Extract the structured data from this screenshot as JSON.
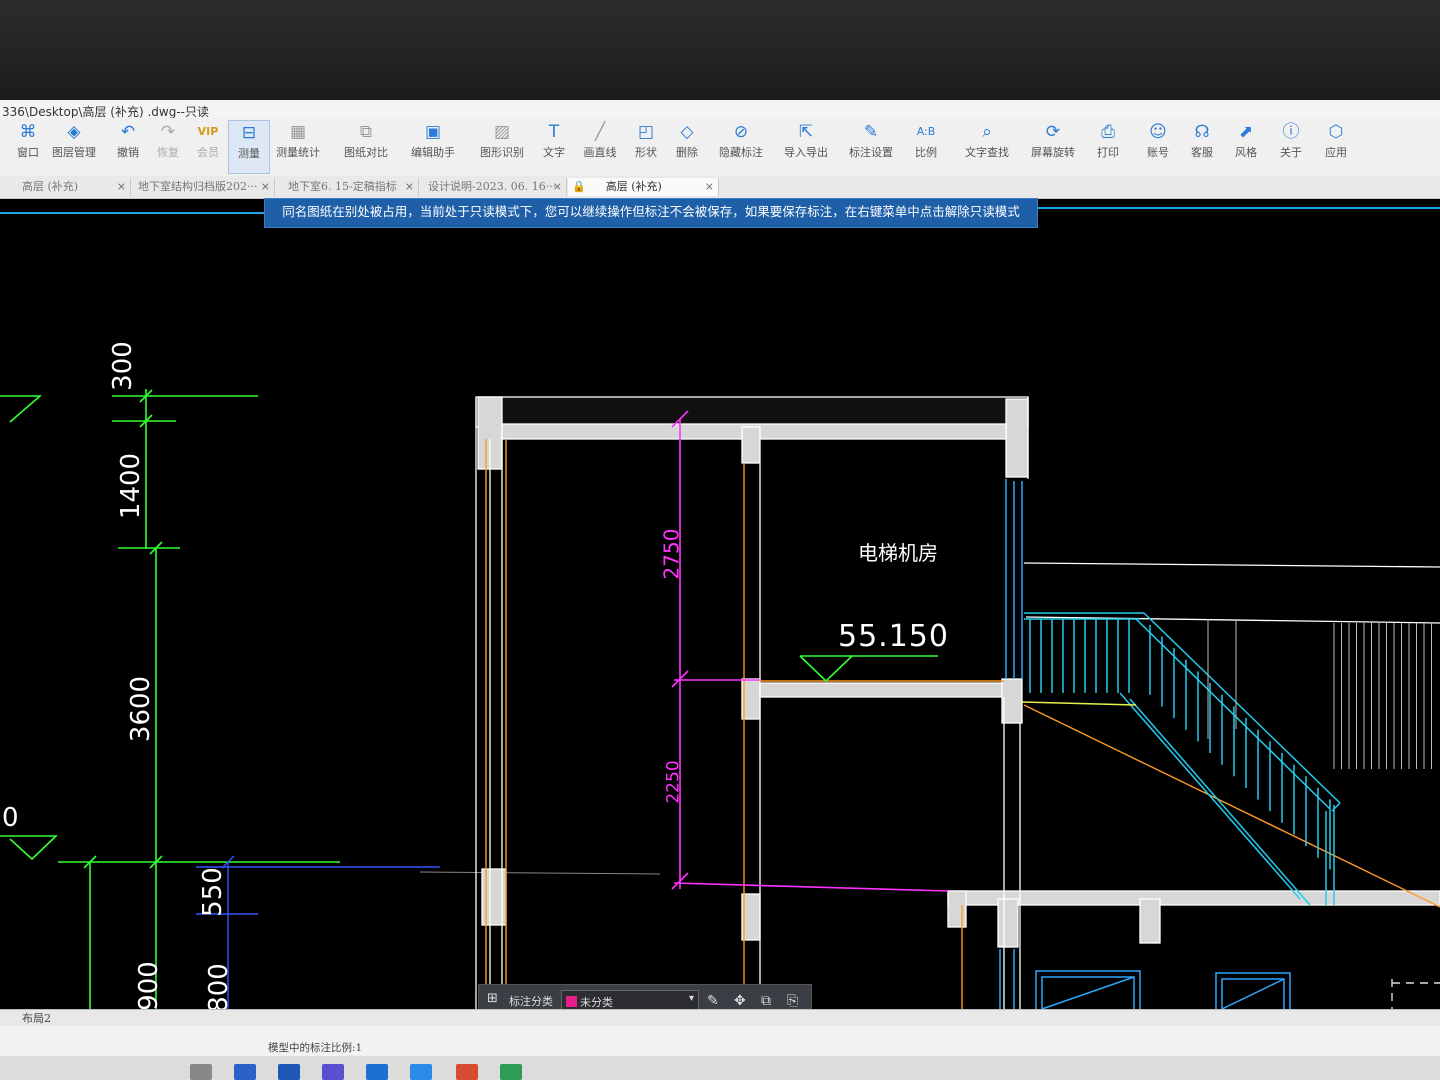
{
  "window": {
    "title": "336\\Desktop\\高层 (补充) .dwg--只读"
  },
  "toolbar": {
    "items": [
      {
        "label": "窗口",
        "icon": "window-icon"
      },
      {
        "label": "图层管理",
        "icon": "layers-icon"
      },
      {
        "label": "撤销",
        "icon": "undo-icon"
      },
      {
        "label": "恢复",
        "icon": "redo-icon"
      },
      {
        "label": "会员",
        "icon": "vip-icon"
      },
      {
        "label": "测量",
        "icon": "measure-icon"
      },
      {
        "label": "测量统计",
        "icon": "measure-stats-icon"
      },
      {
        "label": "图纸对比",
        "icon": "compare-icon"
      },
      {
        "label": "编辑助手",
        "icon": "edit-assistant-icon"
      },
      {
        "label": "图形识别",
        "icon": "shape-recognition-icon"
      },
      {
        "label": "文字",
        "icon": "text-icon"
      },
      {
        "label": "画直线",
        "icon": "line-icon"
      },
      {
        "label": "形状",
        "icon": "shape-icon"
      },
      {
        "label": "删除",
        "icon": "eraser-icon"
      },
      {
        "label": "隐藏标注",
        "icon": "hide-annotation-icon"
      },
      {
        "label": "导入导出",
        "icon": "import-export-icon"
      },
      {
        "label": "标注设置",
        "icon": "annotation-settings-icon"
      },
      {
        "label": "比例",
        "icon": "scale-icon"
      },
      {
        "label": "文字查找",
        "icon": "text-search-icon"
      },
      {
        "label": "屏幕旋转",
        "icon": "screen-rotate-icon"
      },
      {
        "label": "打印",
        "icon": "print-icon"
      },
      {
        "label": "账号",
        "icon": "account-icon"
      },
      {
        "label": "客服",
        "icon": "headset-icon"
      },
      {
        "label": "风格",
        "icon": "style-icon"
      },
      {
        "label": "关于",
        "icon": "info-icon"
      },
      {
        "label": "应用",
        "icon": "apps-icon"
      }
    ],
    "active": "测量"
  },
  "tabs": [
    {
      "label": "高层 (补充)"
    },
    {
      "label": "地下室结构归档版202···"
    },
    {
      "label": "地下室6. 15-定稿指标"
    },
    {
      "label": "设计说明-2023. 06. 16···"
    },
    {
      "label": "高层 (补充)"
    }
  ],
  "notice": "同名图纸在别处被占用，当前处于只读模式下，您可以继续操作但标注不会被保存，如果要保存标注，在右键菜单中点击解除只读模式",
  "drawing": {
    "room_label": "电梯机房",
    "elevation": "55.150",
    "dims_left": [
      "300",
      "1400",
      "3600",
      "550",
      "900",
      "800",
      "0"
    ],
    "dims_magenta": [
      "2750",
      "2250"
    ]
  },
  "annotation_bar": {
    "label": "标注分类",
    "selected": "未分类",
    "selected_color": "#e61e8a"
  },
  "layout_tabs": [
    "布局2"
  ],
  "status": {
    "text": "模型中的标注比例:1"
  },
  "colors": {
    "accent": "#2c7bd6",
    "notice_bg": "#1e5fa8",
    "canvas_bg": "#000000",
    "dim_green": "#33ff33",
    "dim_magenta": "#ff33ff",
    "stair_cyan": "#22ccee"
  }
}
